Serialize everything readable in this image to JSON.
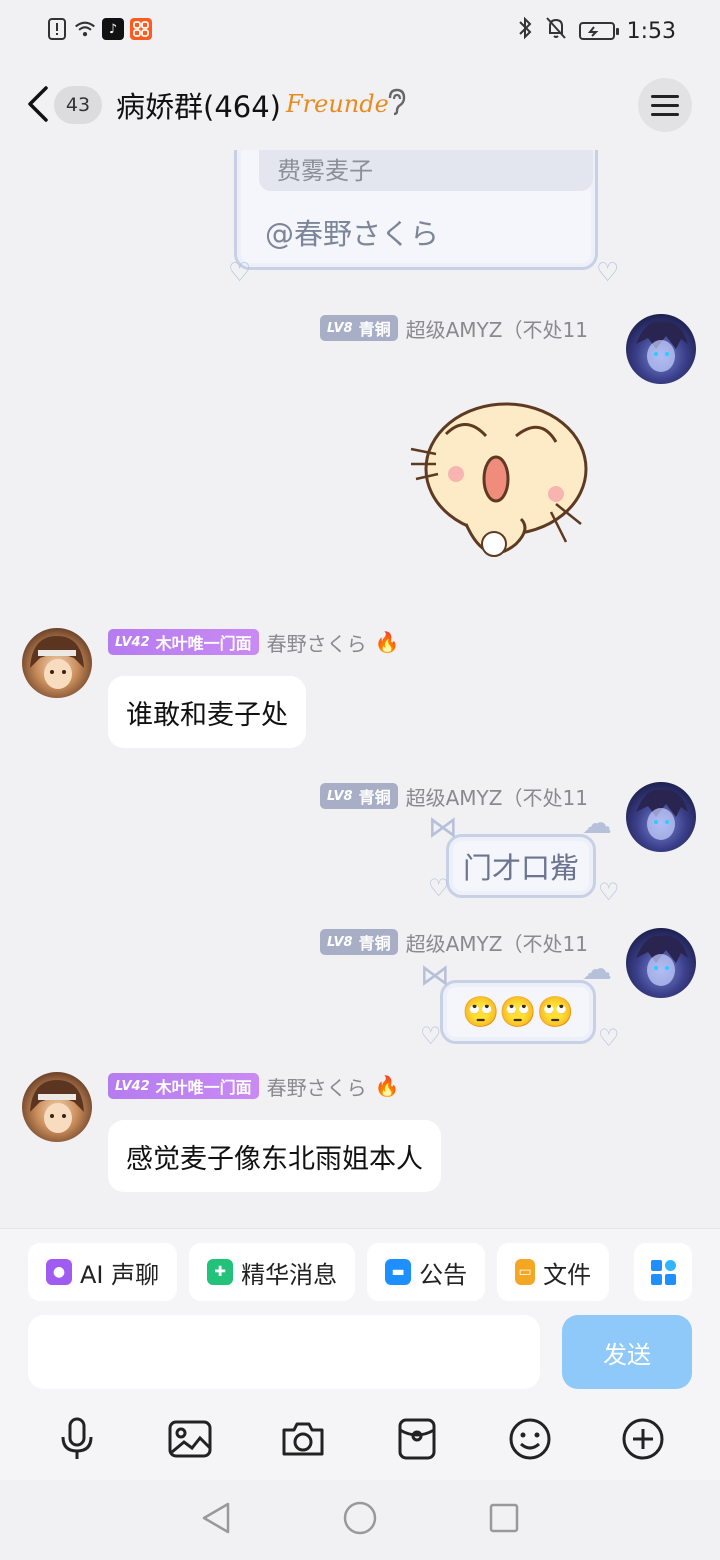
{
  "status_bar": {
    "time": "1:53",
    "app_icons": [
      "notification-icon",
      "wifi-icon",
      "tiktok-icon",
      "app-icon"
    ],
    "right_icons": [
      "bluetooth-icon",
      "mute-icon",
      "battery-icon"
    ]
  },
  "header": {
    "unread_count": "43",
    "title": "病娇群(464)",
    "tag": "Freunde"
  },
  "messages": {
    "quote_partial": {
      "quoted_text": "费雾麦子",
      "mention": "@春野さくら"
    },
    "m1": {
      "level": "LV8",
      "rank": "青铜",
      "sender": "超级AMYZ（不处11",
      "type": "sticker",
      "sticker_name": "laughing-cat"
    },
    "m2": {
      "level": "LV42",
      "rank": "木叶唯一门面",
      "sender": "春野さくら",
      "text": "谁敢和麦子处"
    },
    "m3": {
      "level": "LV8",
      "rank": "青铜",
      "sender": "超级AMYZ（不处11",
      "text": "门才口觜"
    },
    "m4": {
      "level": "LV8",
      "rank": "青铜",
      "sender": "超级AMYZ（不处11",
      "text": "🙄🙄🙄"
    },
    "m5": {
      "level": "LV42",
      "rank": "木叶唯一门面",
      "sender": "春野さくら",
      "text": "感觉麦子像东北雨姐本人"
    }
  },
  "quick_actions": [
    {
      "label": "AI 声聊",
      "icon": "ai-voice-icon",
      "color": "#a05cf0"
    },
    {
      "label": "精华消息",
      "icon": "highlight-icon",
      "color": "#22c27a"
    },
    {
      "label": "公告",
      "icon": "announcement-icon",
      "color": "#1e8fff"
    },
    {
      "label": "文件",
      "icon": "folder-icon",
      "color": "#f5a623"
    }
  ],
  "composer": {
    "placeholder": "",
    "send_label": "发送"
  },
  "toolbar_icons": [
    "microphone-icon",
    "image-icon",
    "camera-icon",
    "red-packet-icon",
    "emoji-icon",
    "plus-icon"
  ],
  "nav": [
    "back-nav-icon",
    "home-nav-icon",
    "recents-nav-icon"
  ]
}
